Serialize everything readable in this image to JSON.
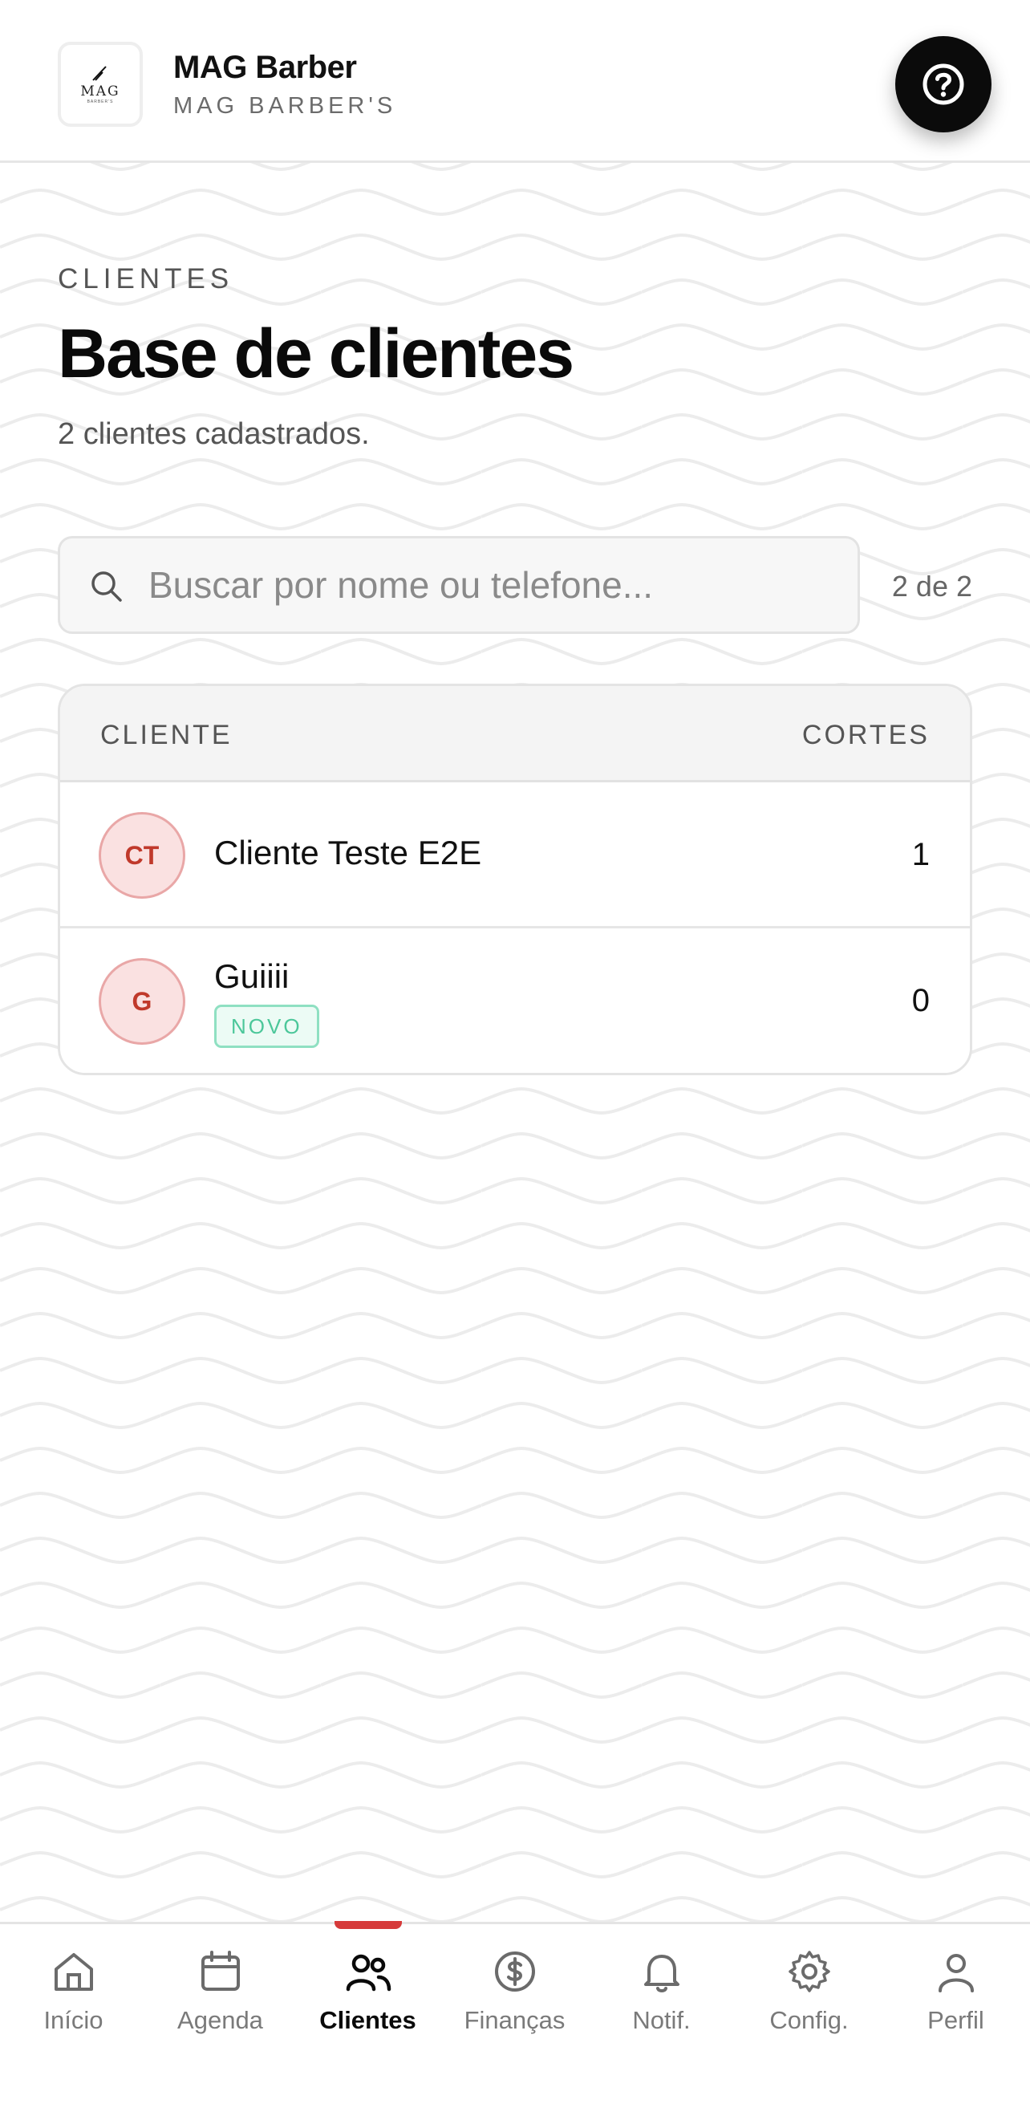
{
  "header": {
    "logo_text": "MAG",
    "logo_subtext": "BARBER'S",
    "brand_name": "MAG Barber",
    "brand_subtitle": "MAG BARBER'S",
    "help_icon": "question-circle-icon"
  },
  "main": {
    "eyebrow": "CLIENTES",
    "title": "Base de clientes",
    "subtitle": "2 clientes cadastrados.",
    "search": {
      "placeholder": "Buscar por nome ou telefone...",
      "value": "",
      "icon": "search-icon"
    },
    "result_count": "2 de 2"
  },
  "table": {
    "columns": {
      "client": "CLIENTE",
      "cuts": "CORTES"
    },
    "rows": [
      {
        "initials": "CT",
        "name": "Cliente Teste E2E",
        "badge": "",
        "cuts": "1"
      },
      {
        "initials": "G",
        "name": "Guiiii",
        "badge": "NOVO",
        "cuts": "0"
      }
    ]
  },
  "bottom_nav": {
    "items": [
      {
        "label": "Início",
        "icon": "home-icon"
      },
      {
        "label": "Agenda",
        "icon": "calendar-icon"
      },
      {
        "label": "Clientes",
        "icon": "users-icon",
        "active": true
      },
      {
        "label": "Finanças",
        "icon": "dollar-circle-icon"
      },
      {
        "label": "Notif.",
        "icon": "bell-icon"
      },
      {
        "label": "Config.",
        "icon": "gear-icon"
      },
      {
        "label": "Perfil",
        "icon": "user-icon"
      }
    ]
  },
  "colors": {
    "accent": "#d63a3a",
    "avatar_bg": "#fae1e1",
    "avatar_text": "#c0392b",
    "badge_green": "#4cc79a",
    "dark": "#0b0b0b"
  }
}
